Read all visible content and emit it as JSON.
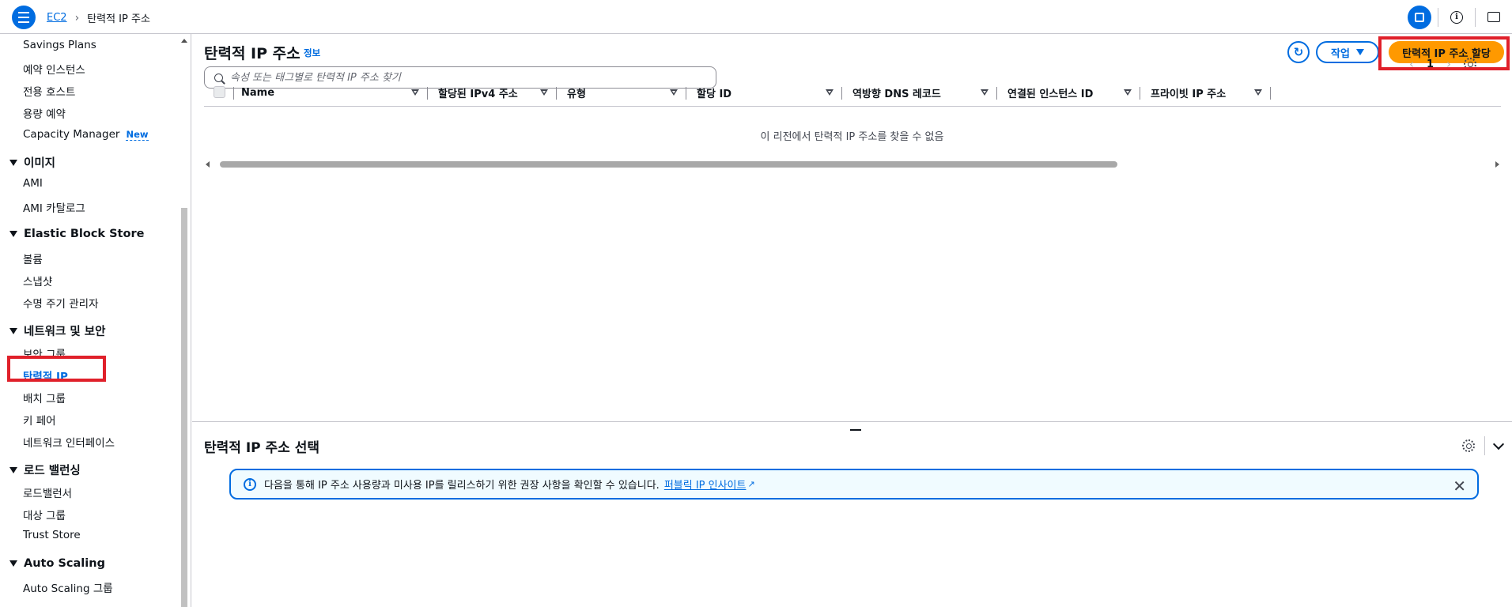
{
  "breadcrumb": {
    "root": "EC2",
    "current": "탄력적 IP 주소"
  },
  "sidebar": {
    "items": [
      {
        "type": "item",
        "label": "Savings Plans"
      },
      {
        "type": "item",
        "label": "예약 인스턴스"
      },
      {
        "type": "item",
        "label": "전용 호스트"
      },
      {
        "type": "item",
        "label": "용량 예약"
      },
      {
        "type": "item",
        "label": "Capacity Manager",
        "badge": "New"
      },
      {
        "type": "head",
        "label": "이미지"
      },
      {
        "type": "item",
        "label": "AMI"
      },
      {
        "type": "item",
        "label": "AMI 카탈로그"
      },
      {
        "type": "head",
        "label": "Elastic Block Store"
      },
      {
        "type": "item",
        "label": "볼륨"
      },
      {
        "type": "item",
        "label": "스냅샷"
      },
      {
        "type": "item",
        "label": "수명 주기 관리자"
      },
      {
        "type": "head",
        "label": "네트워크 및 보안"
      },
      {
        "type": "item",
        "label": "보안 그룹"
      },
      {
        "type": "item",
        "label": "탄력적 IP",
        "active": true
      },
      {
        "type": "item",
        "label": "배치 그룹"
      },
      {
        "type": "item",
        "label": "키 페어"
      },
      {
        "type": "item",
        "label": "네트워크 인터페이스"
      },
      {
        "type": "head",
        "label": "로드 밸런싱"
      },
      {
        "type": "item",
        "label": "로드밸런서"
      },
      {
        "type": "item",
        "label": "대상 그룹"
      },
      {
        "type": "item",
        "label": "Trust Store"
      },
      {
        "type": "head",
        "label": "Auto Scaling"
      },
      {
        "type": "item",
        "label": "Auto Scaling 그룹"
      }
    ]
  },
  "main": {
    "title": "탄력적 IP 주소",
    "info_link": "정보",
    "refresh_icon": "refresh-icon",
    "actions_label": "작업",
    "primary_label": "탄력적 IP 주소 할당",
    "search_placeholder": "속성 또는 태그별로 탄력적 IP 주소 찾기",
    "page_number": "1",
    "columns": [
      "Name",
      "할당된 IPv4 주소",
      "유형",
      "할당 ID",
      "역방향 DNS 레코드",
      "연결된 인스턴스 ID",
      "프라이빗 IP 주소"
    ],
    "empty_message": "이 리전에서 탄력적 IP 주소를 찾을 수 없음"
  },
  "split_panel": {
    "title": "탄력적 IP 주소 선택",
    "alert_text": "다음을 통해 IP 주소 사용량과 미사용 IP를 릴리스하기 위한 권장 사항을 확인할 수 있습니다.",
    "alert_link": "퍼블릭 IP 인사이트"
  },
  "colors": {
    "accent": "#006ce0",
    "primary": "#ff9900",
    "highlight": "#e0202a"
  }
}
